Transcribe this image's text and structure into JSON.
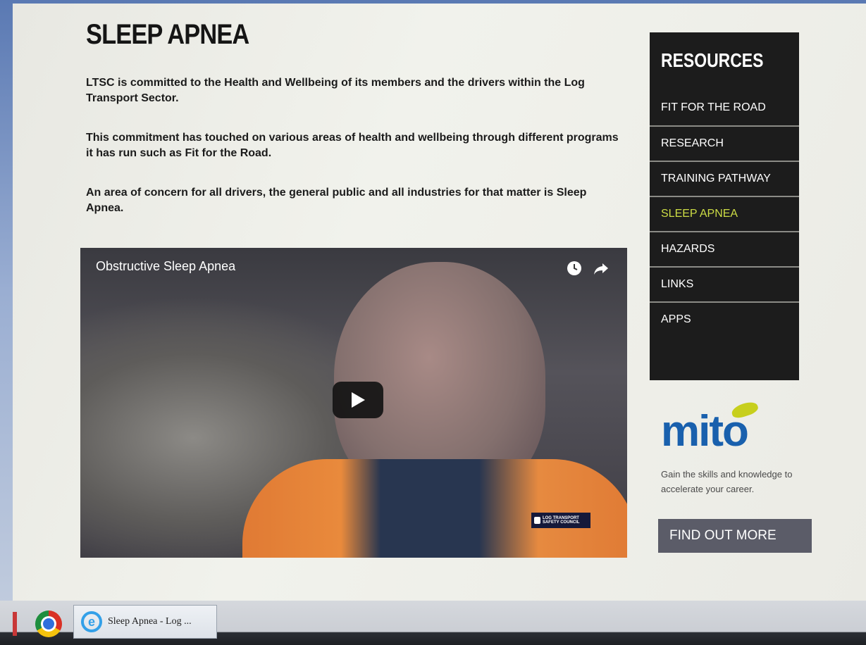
{
  "page": {
    "title": "SLEEP APNEA",
    "paragraphs": [
      "LTSC is committed to the Health and Wellbeing of its members and the drivers within the Log Transport Sector.",
      "This commitment has touched on various areas of health and wellbeing through different programs it has run such as Fit for the Road.",
      "An area of concern for all drivers, the general public and all industries for that matter is Sleep Apnea."
    ]
  },
  "video": {
    "title": "Obstructive Sleep Apnea",
    "icons": [
      "watch-later-icon",
      "share-icon"
    ],
    "play_icon": "play-icon",
    "logo_text": "LOG TRANSPORT SAFETY COUNCIL"
  },
  "sidebar": {
    "heading": "RESOURCES",
    "items": [
      {
        "label": "FIT FOR THE ROAD",
        "active": false
      },
      {
        "label": "RESEARCH",
        "active": false
      },
      {
        "label": "TRAINING PATHWAY",
        "active": false
      },
      {
        "label": "SLEEP APNEA",
        "active": true
      },
      {
        "label": "HAZARDS",
        "active": false
      },
      {
        "label": "LINKS",
        "active": false
      },
      {
        "label": "APPS",
        "active": false
      }
    ],
    "active_color": "#cddd45"
  },
  "promo": {
    "logo": "mito",
    "tagline": "Gain the skills and knowledge to accelerate your career.",
    "button_label": "FIND OUT MORE",
    "brand_color": "#1960ad"
  },
  "taskbar": {
    "apps": [
      {
        "icon": "chrome-icon"
      },
      {
        "icon": "internet-explorer-icon",
        "label": "Sleep Apnea - Log ..."
      }
    ]
  }
}
